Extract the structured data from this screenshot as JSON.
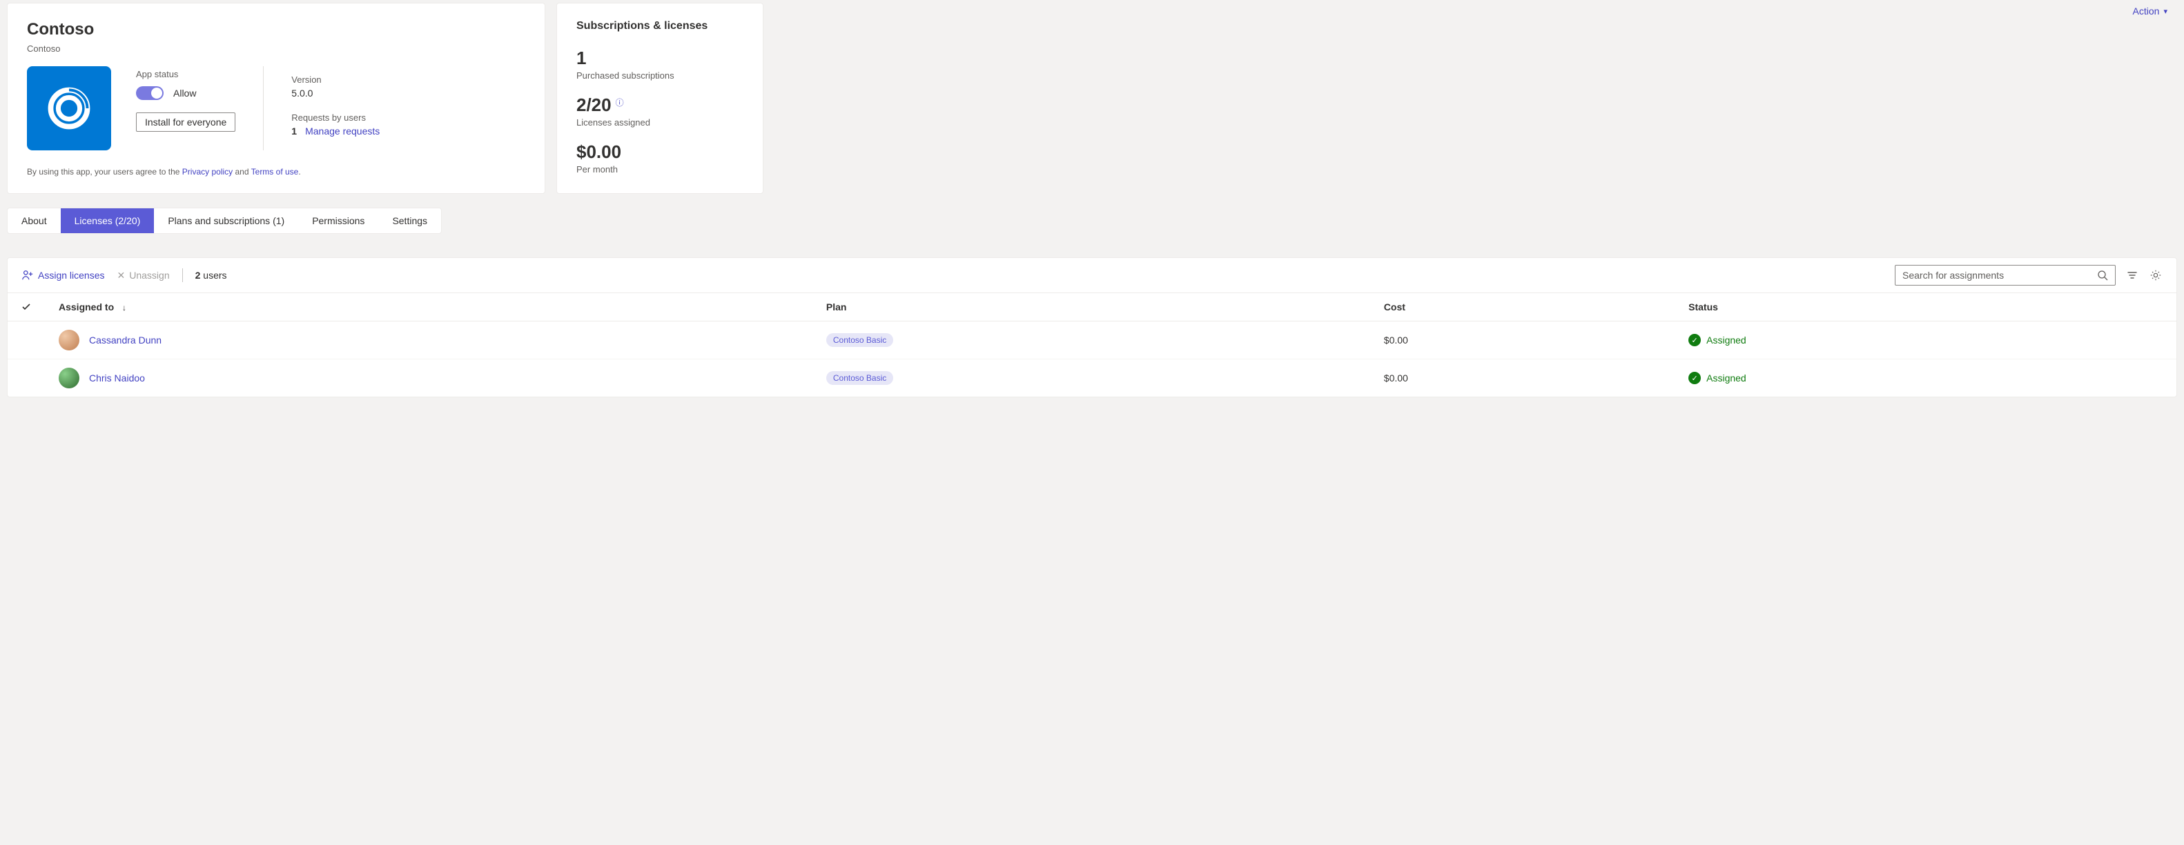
{
  "action_dropdown": "Action",
  "app": {
    "title": "Contoso",
    "subtitle": "Contoso",
    "status_label": "App status",
    "toggle_label": "Allow",
    "install_button": "Install for everyone",
    "version_label": "Version",
    "version_value": "5.0.0",
    "requests_label": "Requests by users",
    "requests_count": "1",
    "manage_requests": "Manage requests",
    "policy_prefix": "By using this app, your users agree to the ",
    "privacy_policy": "Privacy policy",
    "policy_and": " and ",
    "terms_of_use": "Terms of use",
    "policy_suffix": "."
  },
  "subscriptions": {
    "heading": "Subscriptions & licenses",
    "purchased_count": "1",
    "purchased_label": "Purchased subscriptions",
    "licenses_ratio": "2/20",
    "licenses_label": "Licenses assigned",
    "cost_value": "$0.00",
    "cost_label": "Per month"
  },
  "tabs": [
    {
      "key": "about",
      "label": "About"
    },
    {
      "key": "licenses",
      "label": "Licenses (2/20)"
    },
    {
      "key": "plans",
      "label": "Plans and subscriptions (1)"
    },
    {
      "key": "permissions",
      "label": "Permissions"
    },
    {
      "key": "settings",
      "label": "Settings"
    }
  ],
  "toolbar": {
    "assign": "Assign licenses",
    "unassign": "Unassign",
    "user_count_num": "2",
    "user_count_label": " users",
    "search_placeholder": "Search for assignments"
  },
  "table": {
    "headers": {
      "assigned_to": "Assigned to",
      "plan": "Plan",
      "cost": "Cost",
      "status": "Status"
    },
    "rows": [
      {
        "name": "Cassandra Dunn",
        "plan": "Contoso Basic",
        "cost": "$0.00",
        "status": "Assigned"
      },
      {
        "name": "Chris Naidoo",
        "plan": "Contoso Basic",
        "cost": "$0.00",
        "status": "Assigned"
      }
    ]
  }
}
